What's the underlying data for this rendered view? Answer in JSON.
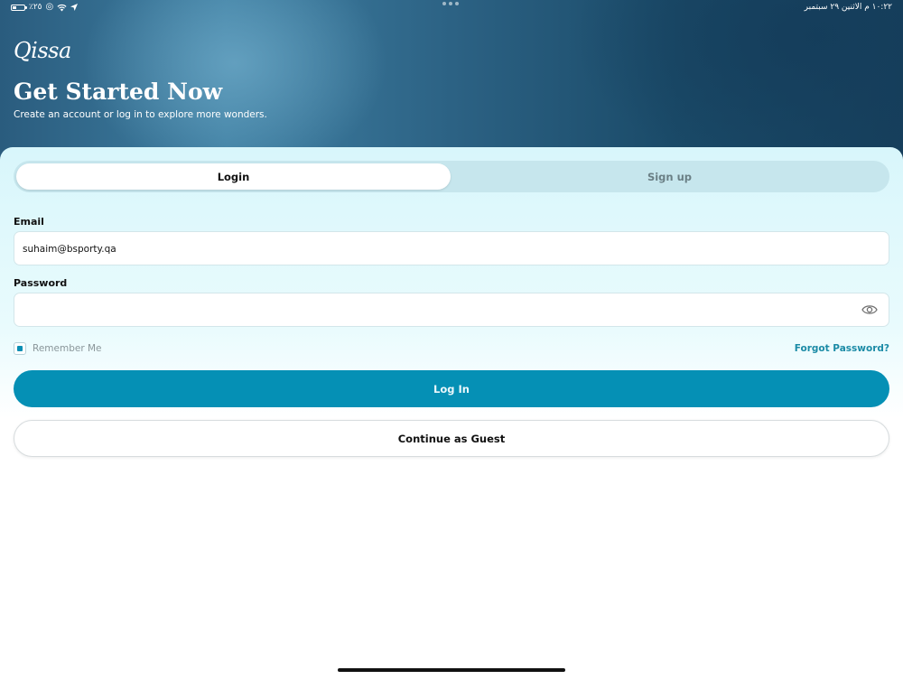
{
  "status_bar": {
    "left_text": "٪٢٥",
    "right_text": "١٠:٢٢ م  الاثنين ٢٩ سبتمبر"
  },
  "hero": {
    "logo": "Qissa",
    "title": "Get Started Now",
    "subtitle": "Create an account or log in to explore more wonders."
  },
  "tabs": {
    "login": "Login",
    "signup": "Sign up",
    "active": "Login"
  },
  "form": {
    "email_label": "Email",
    "email_value": "suhaim@bsporty.qa",
    "password_label": "Password",
    "password_value": "",
    "remember_label": "Remember Me",
    "remember_checked": true,
    "forgot_label": "Forgot Password?"
  },
  "buttons": {
    "login": "Log In",
    "guest": "Continue as Guest"
  },
  "colors": {
    "accent": "#0590b5",
    "link": "#1b8ba6",
    "hero_dark": "#163f5c"
  },
  "icons": {
    "password_toggle": "eye-icon",
    "location": "location-arrow-icon",
    "wifi": "wifi-icon"
  }
}
